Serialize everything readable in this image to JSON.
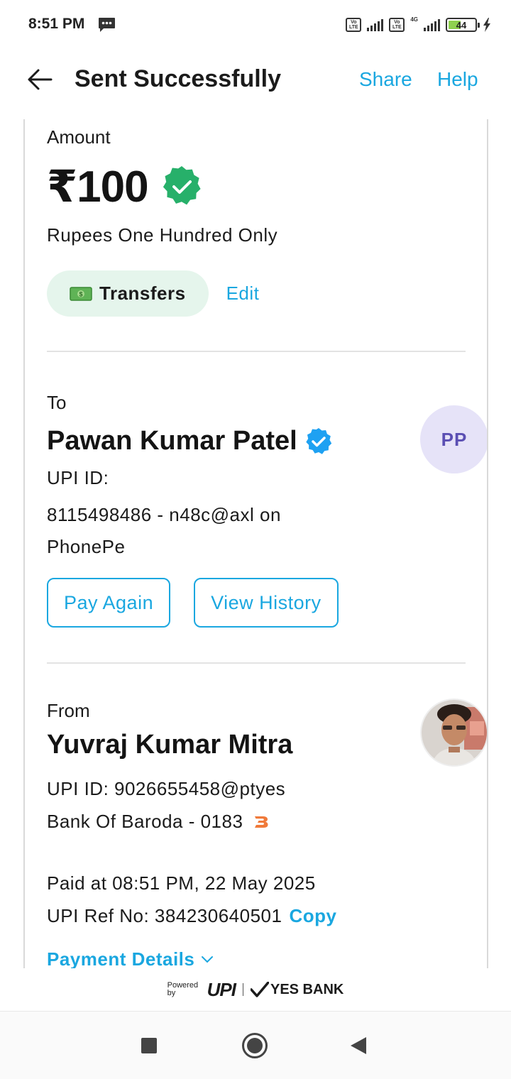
{
  "status_bar": {
    "time": "8:51 PM",
    "battery": "44",
    "network_badge": "Vo LTE",
    "network_type": "4G"
  },
  "header": {
    "title": "Sent Successfully",
    "share_label": "Share",
    "help_label": "Help"
  },
  "amount": {
    "label": "Amount",
    "value": "₹100",
    "words": "Rupees One Hundred Only",
    "category_label": "Transfers",
    "edit_label": "Edit"
  },
  "to": {
    "label": "To",
    "name": "Pawan Kumar Patel",
    "initials": "PP",
    "upi_label": "UPI ID:",
    "upi_id": "8115498486 - n48c@axl on PhonePe",
    "pay_again_label": "Pay Again",
    "view_history_label": "View History"
  },
  "from": {
    "label": "From",
    "name": "Yuvraj Kumar Mitra",
    "upi_id": "UPI ID: 9026655458@ptyes",
    "bank": "Bank Of Baroda - 0183"
  },
  "transaction": {
    "paid_at": "Paid at 08:51 PM, 22 May 2025",
    "ref_no": "UPI Ref No: 384230640501",
    "copy_label": "Copy",
    "details_label": "Payment Details"
  },
  "footer": {
    "powered_by": "Powered by",
    "upi_brand": "UPI",
    "bank_brand": "YES BANK"
  },
  "colors": {
    "accent": "#1aa7e0",
    "success_green": "#27b06a",
    "verified_blue": "#1ea1f2",
    "chip_bg": "#e5f5ec"
  }
}
